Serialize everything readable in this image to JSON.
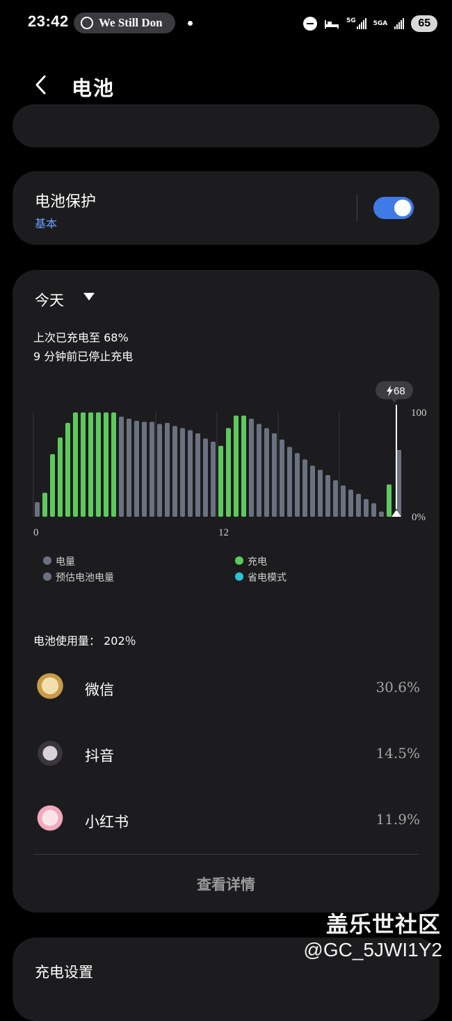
{
  "status_bar": {
    "time": "23:42",
    "media_text": "We Still Don",
    "net1": "5G",
    "net2": "5GA",
    "battery": "65"
  },
  "header": {
    "title": "电池"
  },
  "battery_protection": {
    "label": "电池保护",
    "mode": "基本",
    "enabled": true
  },
  "usage_card": {
    "range": "今天",
    "last_charge": "上次已充电至 68%",
    "stopped": "9 分钟前已停止充电",
    "chart": {
      "bubble": "68",
      "y_top": "100",
      "y_bottom": "0%",
      "x_labels": [
        "0",
        "12"
      ],
      "colors": {
        "charging": "#5ec95e",
        "level": "#6a7180",
        "estimated": "#6a7180",
        "saver": "#2bc4d6"
      },
      "bars": [
        {
          "v": 14,
          "c": "l"
        },
        {
          "v": 23,
          "c": "c"
        },
        {
          "v": 60,
          "c": "c"
        },
        {
          "v": 76,
          "c": "c"
        },
        {
          "v": 90,
          "c": "c"
        },
        {
          "v": 100,
          "c": "c"
        },
        {
          "v": 100,
          "c": "c"
        },
        {
          "v": 100,
          "c": "c"
        },
        {
          "v": 100,
          "c": "c"
        },
        {
          "v": 100,
          "c": "c"
        },
        {
          "v": 100,
          "c": "c"
        },
        {
          "v": 96,
          "c": "l"
        },
        {
          "v": 94,
          "c": "l"
        },
        {
          "v": 92,
          "c": "l"
        },
        {
          "v": 91,
          "c": "l"
        },
        {
          "v": 91,
          "c": "l"
        },
        {
          "v": 89,
          "c": "l"
        },
        {
          "v": 90,
          "c": "l"
        },
        {
          "v": 87,
          "c": "l"
        },
        {
          "v": 85,
          "c": "l"
        },
        {
          "v": 83,
          "c": "l"
        },
        {
          "v": 80,
          "c": "l"
        },
        {
          "v": 75,
          "c": "l"
        },
        {
          "v": 72,
          "c": "l"
        },
        {
          "v": 68,
          "c": "c"
        },
        {
          "v": 85,
          "c": "c"
        },
        {
          "v": 97,
          "c": "c"
        },
        {
          "v": 97,
          "c": "c"
        },
        {
          "v": 94,
          "c": "l"
        },
        {
          "v": 89,
          "c": "l"
        },
        {
          "v": 85,
          "c": "l"
        },
        {
          "v": 80,
          "c": "l"
        },
        {
          "v": 74,
          "c": "l"
        },
        {
          "v": 67,
          "c": "l"
        },
        {
          "v": 61,
          "c": "l"
        },
        {
          "v": 55,
          "c": "l"
        },
        {
          "v": 49,
          "c": "l"
        },
        {
          "v": 45,
          "c": "l"
        },
        {
          "v": 40,
          "c": "l"
        },
        {
          "v": 35,
          "c": "l"
        },
        {
          "v": 30,
          "c": "l"
        },
        {
          "v": 26,
          "c": "l"
        },
        {
          "v": 22,
          "c": "l"
        },
        {
          "v": 17,
          "c": "l"
        },
        {
          "v": 13,
          "c": "l"
        },
        {
          "v": 5,
          "c": "l"
        },
        {
          "v": 31,
          "c": "c"
        }
      ],
      "estimated_level": 64
    },
    "legend": {
      "level": "电量",
      "charging": "充电",
      "estimated": "预估电池电量",
      "saver": "省电模式"
    },
    "usage_label": "电池使用量： 202％",
    "apps": [
      {
        "name": "微信",
        "percent": "30.6%"
      },
      {
        "name": "抖音",
        "percent": "14.5%"
      },
      {
        "name": "小红书",
        "percent": "11.9%"
      }
    ],
    "details_button": "查看详情"
  },
  "charging_settings": {
    "label": "充电设置"
  },
  "watermark": {
    "line1": "盖乐世社区",
    "line2": "@GC_5JWI1Y2"
  }
}
